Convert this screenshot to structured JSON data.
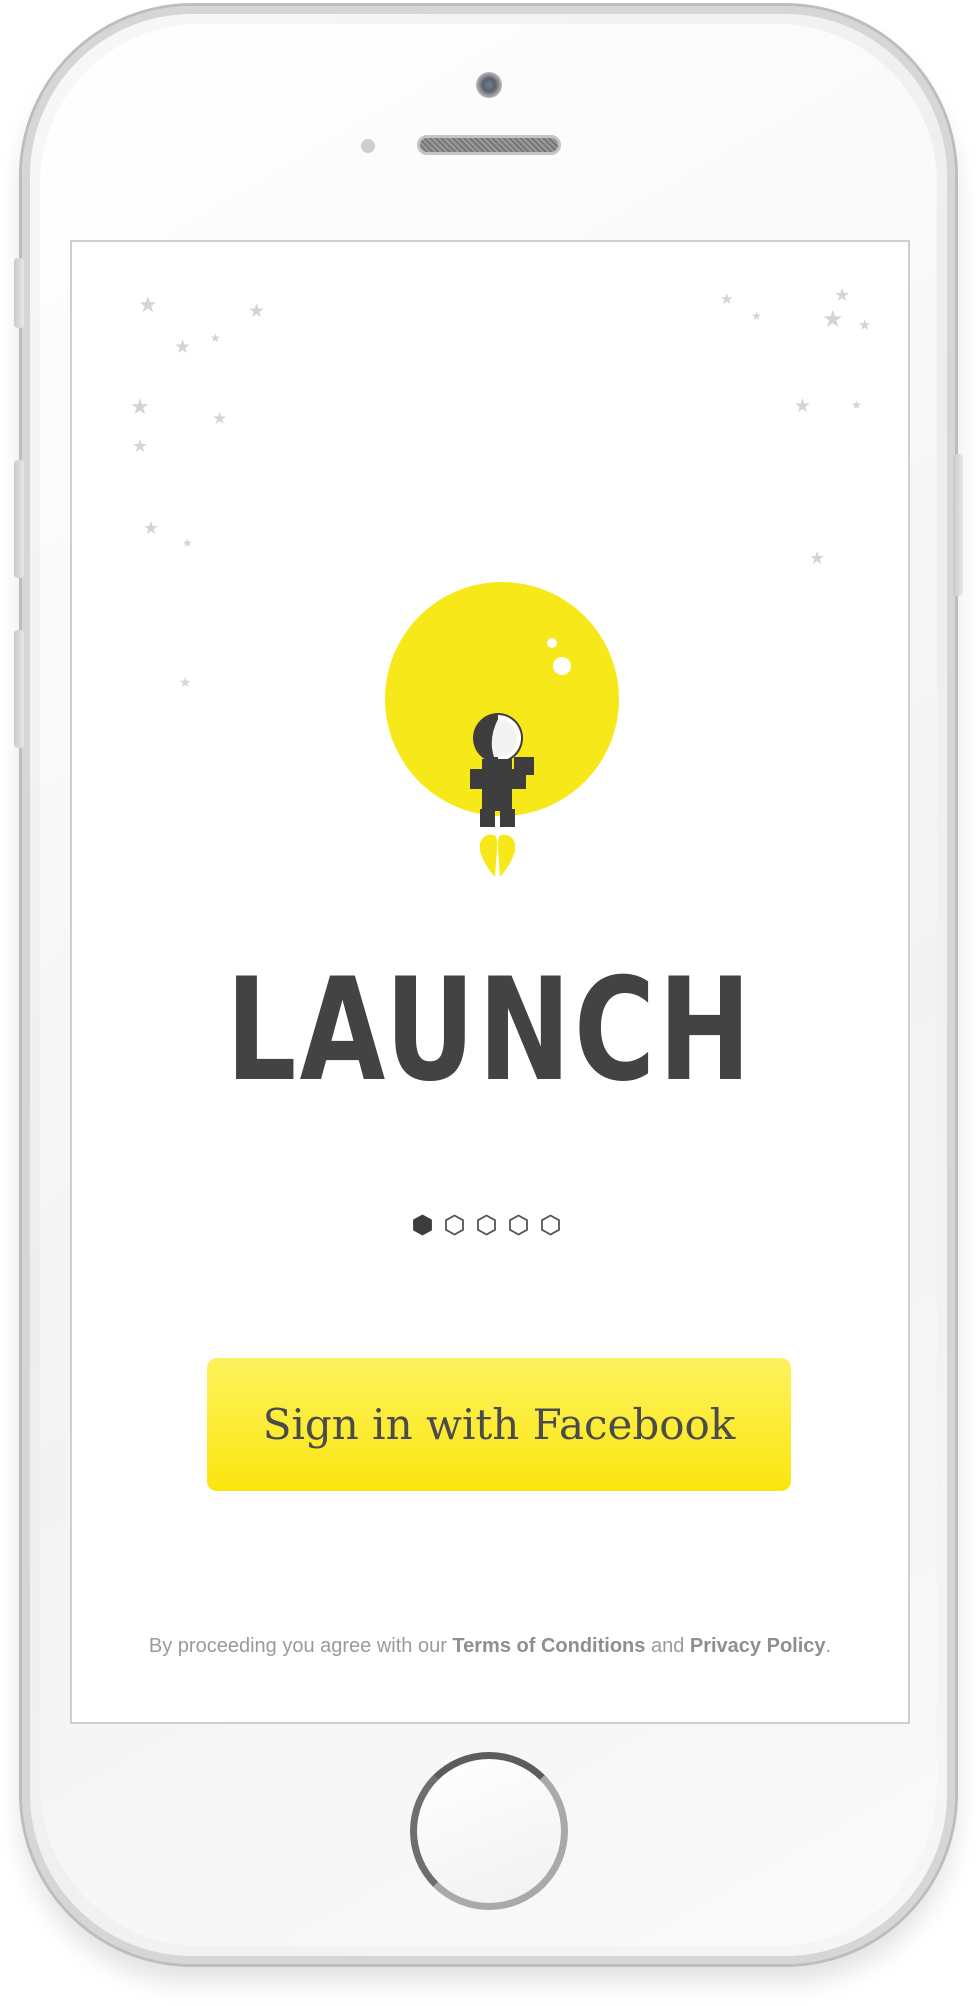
{
  "colors": {
    "accent_yellow": "#f7e81a",
    "button_top": "#fdf35e",
    "button_bottom": "#fbe50f",
    "title_text": "#434343",
    "legal_text": "#9a9a9a",
    "star": "#d4d4d4"
  },
  "screen": {
    "app_title": "LAUNCH",
    "pager": {
      "total_pages": 5,
      "active_index": 0
    },
    "facebook_button_label": "Sign in with Facebook",
    "legal": {
      "prefix": "By proceeding you agree with our ",
      "terms_link": "Terms of Conditions",
      "connector": " and ",
      "privacy_link": "Privacy Policy",
      "suffix": "."
    }
  },
  "device": {
    "frame": "iphone",
    "icons": [
      "front-camera-icon",
      "speaker-grille-icon",
      "home-button-icon"
    ]
  },
  "illustration": {
    "icon": "astronaut-moon-icon",
    "decor": "star-icon"
  }
}
